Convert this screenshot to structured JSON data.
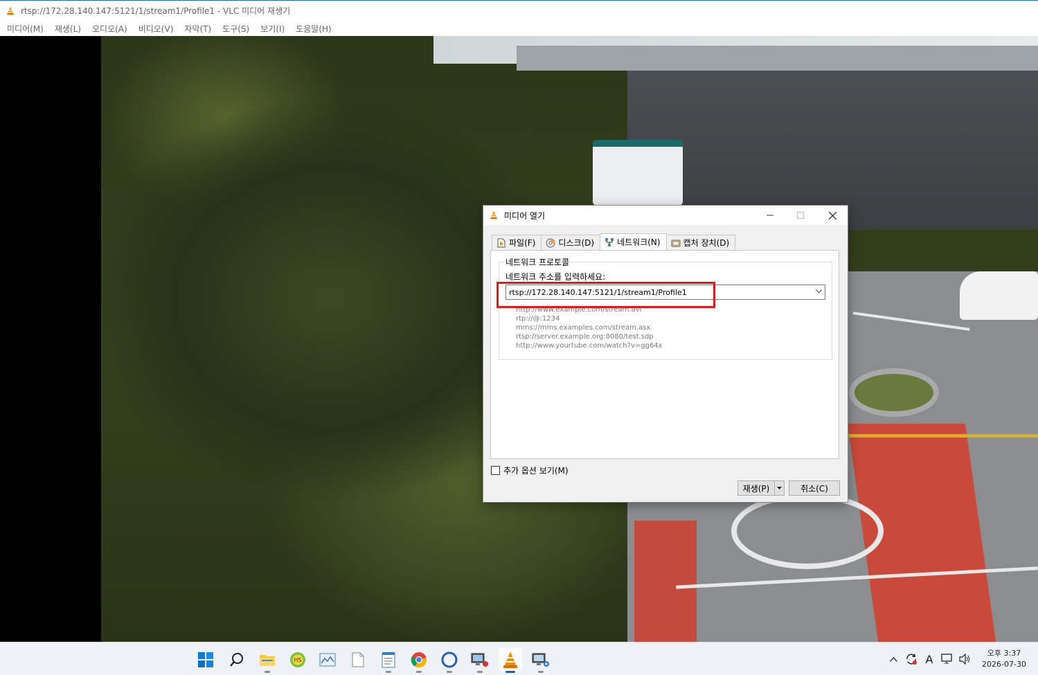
{
  "window": {
    "title": "rtsp://172.28.140.147:5121/1/stream1/Profile1 - VLC 미디어 재생기"
  },
  "menubar": [
    "미디어(M)",
    "재생(L)",
    "오디오(A)",
    "비디오(V)",
    "자막(T)",
    "도구(S)",
    "보기(I)",
    "도움말(H)"
  ],
  "dialog": {
    "title": "미디어 열기",
    "tabs": [
      {
        "label": "파일(F)",
        "icon": "file-icon"
      },
      {
        "label": "디스크(D)",
        "icon": "disc-icon"
      },
      {
        "label": "네트워크(N)",
        "icon": "network-icon",
        "active": true
      },
      {
        "label": "캡처 장치(D)",
        "icon": "capture-device-icon"
      }
    ],
    "group_title": "네트워크 프로토콜",
    "url_label": "네트워크 주소를 입력하세요:",
    "url_value": "rtsp://172.28.140.147:5121/1/stream1/Profile1",
    "examples": [
      "http://www.example.com/stream.avi",
      "rtp://@:1234",
      "mms://mms.examples.com/stream.asx",
      "rtsp://server.example.org:8080/test.sdp",
      "http://www.yourtube.com/watch?v=gg64x"
    ],
    "more_options": "추가 옵션 보기(M)",
    "play_label": "재생(P)",
    "cancel_label": "취소(C)",
    "highlight_color": "#e01b1b"
  },
  "taskbar": {
    "apps": [
      "start-icon",
      "search-icon",
      "file-explorer-icon",
      "hs-app-icon",
      "image-viewer-icon",
      "blank-document-icon",
      "notepad-icon",
      "chrome-icon",
      "cortana-icon",
      "remote-desktop-icon",
      "vlc-icon",
      "network-settings-icon"
    ],
    "clock_time": "오후 3:37",
    "clock_date": "2026-07-30",
    "ime": "A"
  },
  "colors": {
    "accent": "#0067c0",
    "vlc_orange": "#f28c00"
  }
}
